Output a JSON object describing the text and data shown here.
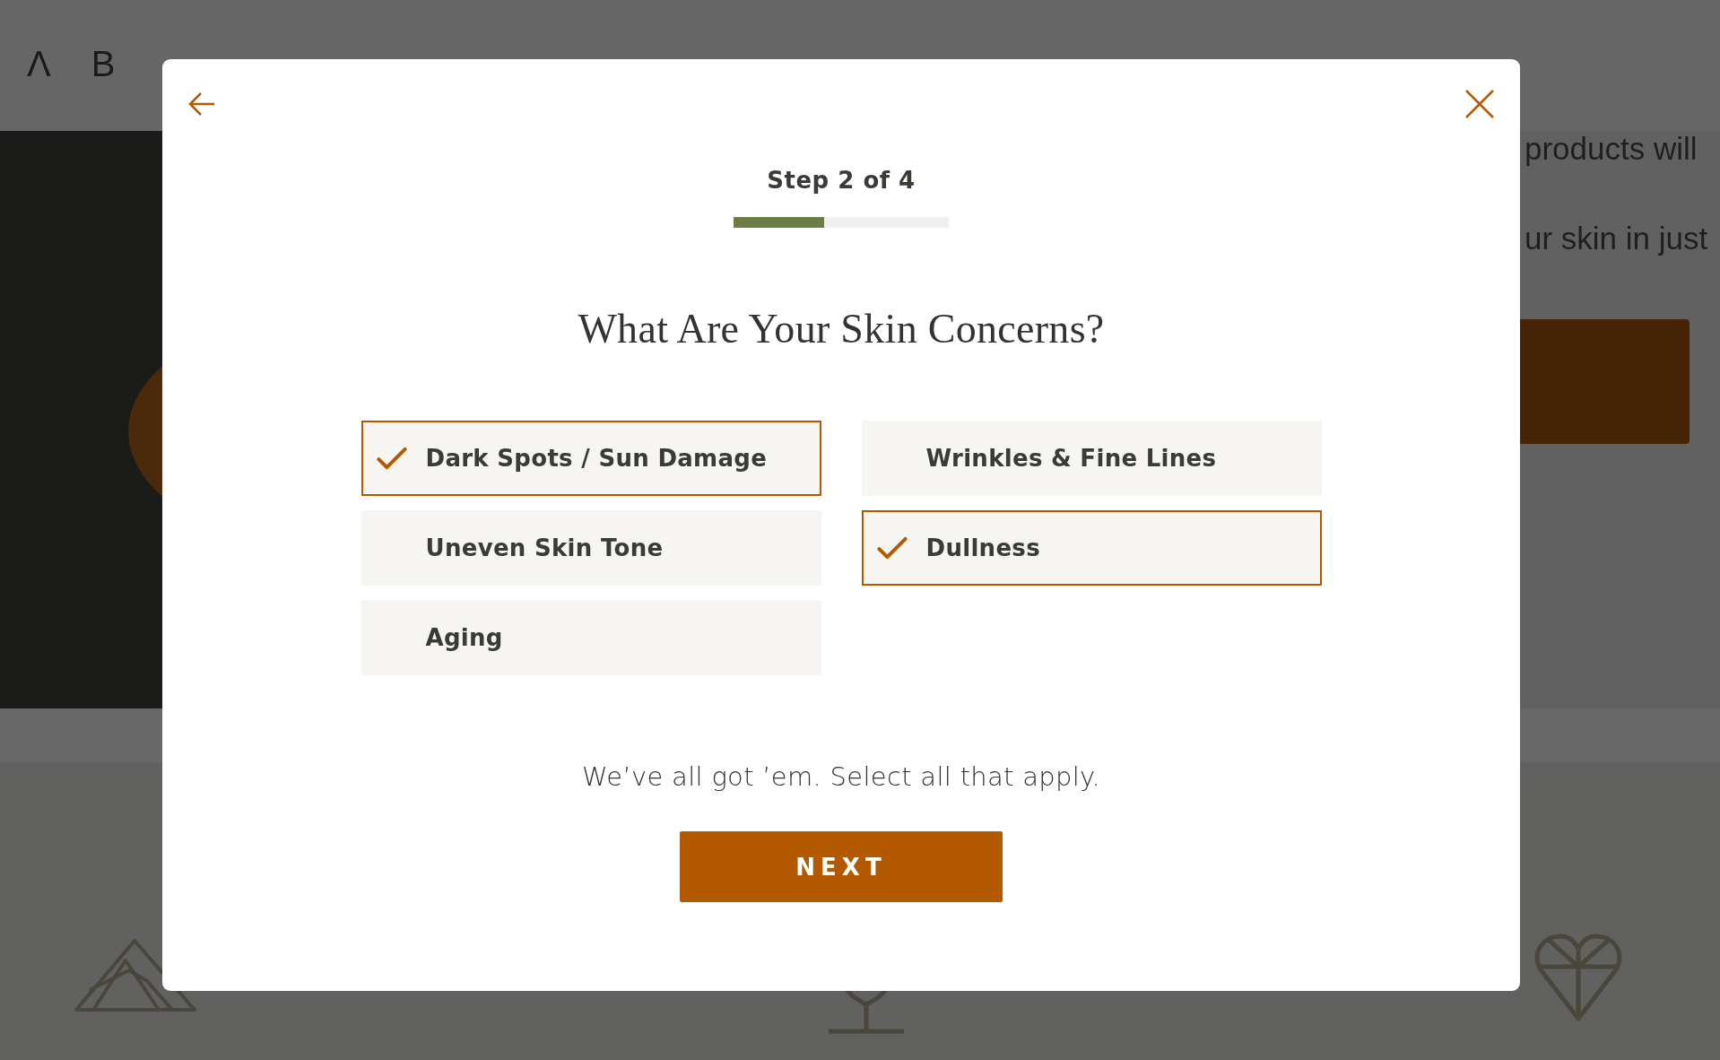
{
  "header": {
    "logo": "Λ B"
  },
  "hero": {
    "text_lines": [
      "products will",
      "ur skin in just"
    ]
  },
  "modal": {
    "step": "Step 2 of 4",
    "progress": {
      "level": 0.42
    },
    "title": "What Are Your Skin Concerns?",
    "options": [
      {
        "label": "Dark Spots / Sun Damage",
        "selected": true
      },
      {
        "label": "Wrinkles & Fine Lines",
        "selected": false
      },
      {
        "label": "Uneven Skin Tone",
        "selected": false
      },
      {
        "label": "Dullness",
        "selected": true
      },
      {
        "label": "Aging",
        "selected": false
      }
    ],
    "hint": "We’ve all got ’em. Select all that apply.",
    "next_button": "NEXT"
  }
}
